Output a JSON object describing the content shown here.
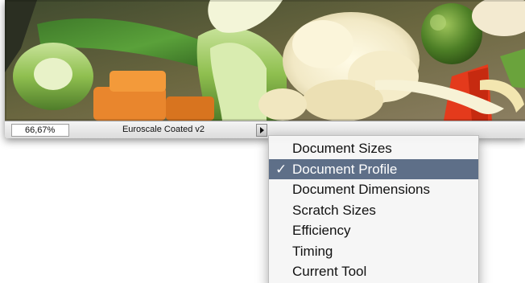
{
  "status_bar": {
    "zoom": "66,67%",
    "profile": "Euroscale Coated v2",
    "menu_button_icon": "right-triangle-icon"
  },
  "menu": {
    "items": [
      {
        "label": "Document Sizes",
        "checked": false
      },
      {
        "label": "Document Profile",
        "checked": true
      },
      {
        "label": "Document Dimensions",
        "checked": false
      },
      {
        "label": "Scratch Sizes",
        "checked": false
      },
      {
        "label": "Efficiency",
        "checked": false
      },
      {
        "label": "Timing",
        "checked": false
      },
      {
        "label": "Current Tool",
        "checked": false
      }
    ],
    "check_glyph": "✓",
    "selected_color": "#5e6f88"
  }
}
